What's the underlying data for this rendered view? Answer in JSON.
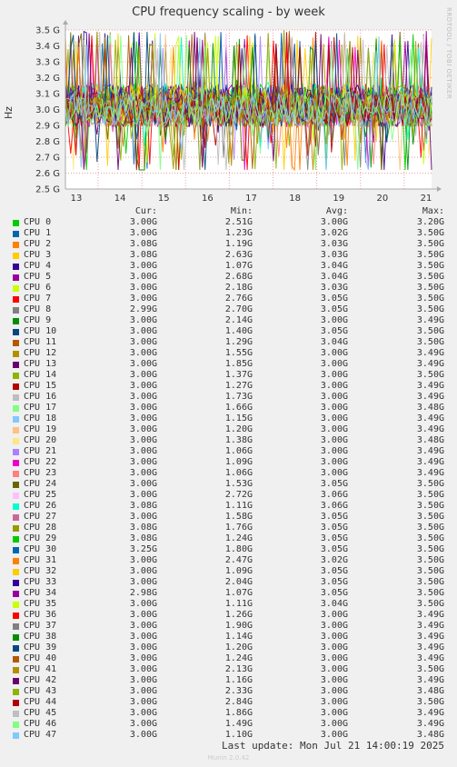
{
  "chart_data": {
    "type": "line",
    "title": "CPU frequency scaling - by week",
    "ylabel": "Hz",
    "xlabel": "",
    "ylim": [
      2.5,
      3.5
    ],
    "yticks": [
      "2.5 G",
      "2.6 G",
      "2.7 G",
      "2.8 G",
      "2.9 G",
      "3.0 G",
      "3.1 G",
      "3.2 G",
      "3.3 G",
      "3.4 G",
      "3.5 G"
    ],
    "xticks": [
      "13",
      "14",
      "15",
      "16",
      "17",
      "18",
      "19",
      "20",
      "21"
    ],
    "grid": true,
    "legend_placement": "bottom",
    "series": [
      {
        "name": "CPU 0",
        "color": "#00cc00",
        "cur": "3.00G",
        "min": "2.51G",
        "avg": "3.00G",
        "max": "3.20G"
      },
      {
        "name": "CPU 1",
        "color": "#0066b3",
        "cur": "3.00G",
        "min": "1.23G",
        "avg": "3.02G",
        "max": "3.50G"
      },
      {
        "name": "CPU 2",
        "color": "#ff8000",
        "cur": "3.08G",
        "min": "1.19G",
        "avg": "3.03G",
        "max": "3.50G"
      },
      {
        "name": "CPU 3",
        "color": "#ffcc00",
        "cur": "3.08G",
        "min": "2.63G",
        "avg": "3.03G",
        "max": "3.50G"
      },
      {
        "name": "CPU 4",
        "color": "#330099",
        "cur": "3.00G",
        "min": "1.07G",
        "avg": "3.04G",
        "max": "3.50G"
      },
      {
        "name": "CPU 5",
        "color": "#990099",
        "cur": "3.00G",
        "min": "2.68G",
        "avg": "3.04G",
        "max": "3.50G"
      },
      {
        "name": "CPU 6",
        "color": "#ccff00",
        "cur": "3.00G",
        "min": "2.18G",
        "avg": "3.03G",
        "max": "3.50G"
      },
      {
        "name": "CPU 7",
        "color": "#ff0000",
        "cur": "3.00G",
        "min": "2.76G",
        "avg": "3.05G",
        "max": "3.50G"
      },
      {
        "name": "CPU 8",
        "color": "#808080",
        "cur": "2.99G",
        "min": "2.70G",
        "avg": "3.05G",
        "max": "3.50G"
      },
      {
        "name": "CPU 9",
        "color": "#008f00",
        "cur": "3.00G",
        "min": "2.14G",
        "avg": "3.00G",
        "max": "3.49G"
      },
      {
        "name": "CPU 10",
        "color": "#00487d",
        "cur": "3.00G",
        "min": "1.40G",
        "avg": "3.05G",
        "max": "3.50G"
      },
      {
        "name": "CPU 11",
        "color": "#b35a00",
        "cur": "3.00G",
        "min": "1.29G",
        "avg": "3.04G",
        "max": "3.50G"
      },
      {
        "name": "CPU 12",
        "color": "#b38f00",
        "cur": "3.00G",
        "min": "1.55G",
        "avg": "3.00G",
        "max": "3.49G"
      },
      {
        "name": "CPU 13",
        "color": "#6b006b",
        "cur": "3.00G",
        "min": "1.85G",
        "avg": "3.00G",
        "max": "3.49G"
      },
      {
        "name": "CPU 14",
        "color": "#8fb300",
        "cur": "3.00G",
        "min": "1.37G",
        "avg": "3.00G",
        "max": "3.50G"
      },
      {
        "name": "CPU 15",
        "color": "#b30000",
        "cur": "3.00G",
        "min": "1.27G",
        "avg": "3.00G",
        "max": "3.49G"
      },
      {
        "name": "CPU 16",
        "color": "#bebebe",
        "cur": "3.00G",
        "min": "1.73G",
        "avg": "3.00G",
        "max": "3.49G"
      },
      {
        "name": "CPU 17",
        "color": "#80ff80",
        "cur": "3.00G",
        "min": "1.66G",
        "avg": "3.00G",
        "max": "3.48G"
      },
      {
        "name": "CPU 18",
        "color": "#80c9ff",
        "cur": "3.00G",
        "min": "1.15G",
        "avg": "3.00G",
        "max": "3.49G"
      },
      {
        "name": "CPU 19",
        "color": "#ffc080",
        "cur": "3.00G",
        "min": "1.20G",
        "avg": "3.00G",
        "max": "3.49G"
      },
      {
        "name": "CPU 20",
        "color": "#ffe680",
        "cur": "3.00G",
        "min": "1.38G",
        "avg": "3.00G",
        "max": "3.48G"
      },
      {
        "name": "CPU 21",
        "color": "#aa80ff",
        "cur": "3.00G",
        "min": "1.06G",
        "avg": "3.00G",
        "max": "3.49G"
      },
      {
        "name": "CPU 22",
        "color": "#ee00cc",
        "cur": "3.00G",
        "min": "1.09G",
        "avg": "3.00G",
        "max": "3.49G"
      },
      {
        "name": "CPU 23",
        "color": "#ff8080",
        "cur": "3.00G",
        "min": "1.06G",
        "avg": "3.00G",
        "max": "3.49G"
      },
      {
        "name": "CPU 24",
        "color": "#666600",
        "cur": "3.00G",
        "min": "1.53G",
        "avg": "3.05G",
        "max": "3.50G"
      },
      {
        "name": "CPU 25",
        "color": "#ffbfff",
        "cur": "3.00G",
        "min": "2.72G",
        "avg": "3.06G",
        "max": "3.50G"
      },
      {
        "name": "CPU 26",
        "color": "#00ffcc",
        "cur": "3.08G",
        "min": "1.11G",
        "avg": "3.06G",
        "max": "3.50G"
      },
      {
        "name": "CPU 27",
        "color": "#cc6699",
        "cur": "3.00G",
        "min": "1.58G",
        "avg": "3.05G",
        "max": "3.50G"
      },
      {
        "name": "CPU 28",
        "color": "#999900",
        "cur": "3.08G",
        "min": "1.76G",
        "avg": "3.05G",
        "max": "3.50G"
      },
      {
        "name": "CPU 29",
        "color": "#00cc00",
        "cur": "3.08G",
        "min": "1.24G",
        "avg": "3.05G",
        "max": "3.50G"
      },
      {
        "name": "CPU 30",
        "color": "#0066b3",
        "cur": "3.25G",
        "min": "1.80G",
        "avg": "3.05G",
        "max": "3.50G"
      },
      {
        "name": "CPU 31",
        "color": "#ff8000",
        "cur": "3.00G",
        "min": "2.47G",
        "avg": "3.02G",
        "max": "3.50G"
      },
      {
        "name": "CPU 32",
        "color": "#ffcc00",
        "cur": "3.00G",
        "min": "1.09G",
        "avg": "3.05G",
        "max": "3.50G"
      },
      {
        "name": "CPU 33",
        "color": "#330099",
        "cur": "3.00G",
        "min": "2.04G",
        "avg": "3.05G",
        "max": "3.50G"
      },
      {
        "name": "CPU 34",
        "color": "#990099",
        "cur": "2.98G",
        "min": "1.07G",
        "avg": "3.05G",
        "max": "3.50G"
      },
      {
        "name": "CPU 35",
        "color": "#ccff00",
        "cur": "3.00G",
        "min": "1.11G",
        "avg": "3.04G",
        "max": "3.50G"
      },
      {
        "name": "CPU 36",
        "color": "#ff0000",
        "cur": "3.00G",
        "min": "1.26G",
        "avg": "3.00G",
        "max": "3.49G"
      },
      {
        "name": "CPU 37",
        "color": "#808080",
        "cur": "3.00G",
        "min": "1.90G",
        "avg": "3.00G",
        "max": "3.49G"
      },
      {
        "name": "CPU 38",
        "color": "#008f00",
        "cur": "3.00G",
        "min": "1.14G",
        "avg": "3.00G",
        "max": "3.49G"
      },
      {
        "name": "CPU 39",
        "color": "#00487d",
        "cur": "3.00G",
        "min": "1.20G",
        "avg": "3.00G",
        "max": "3.49G"
      },
      {
        "name": "CPU 40",
        "color": "#b35a00",
        "cur": "3.00G",
        "min": "1.24G",
        "avg": "3.00G",
        "max": "3.49G"
      },
      {
        "name": "CPU 41",
        "color": "#b38f00",
        "cur": "3.00G",
        "min": "2.13G",
        "avg": "3.00G",
        "max": "3.50G"
      },
      {
        "name": "CPU 42",
        "color": "#6b006b",
        "cur": "3.00G",
        "min": "1.16G",
        "avg": "3.00G",
        "max": "3.49G"
      },
      {
        "name": "CPU 43",
        "color": "#8fb300",
        "cur": "3.00G",
        "min": "2.33G",
        "avg": "3.00G",
        "max": "3.48G"
      },
      {
        "name": "CPU 44",
        "color": "#b30000",
        "cur": "3.00G",
        "min": "2.84G",
        "avg": "3.00G",
        "max": "3.50G"
      },
      {
        "name": "CPU 45",
        "color": "#bebebe",
        "cur": "3.00G",
        "min": "1.86G",
        "avg": "3.00G",
        "max": "3.49G"
      },
      {
        "name": "CPU 46",
        "color": "#80ff80",
        "cur": "3.00G",
        "min": "1.49G",
        "avg": "3.00G",
        "max": "3.49G"
      },
      {
        "name": "CPU 47",
        "color": "#80c9ff",
        "cur": "3.00G",
        "min": "1.10G",
        "avg": "3.00G",
        "max": "3.48G"
      }
    ]
  },
  "legend_headers": {
    "cur": "Cur:",
    "min": "Min:",
    "avg": "Avg:",
    "max": "Max:"
  },
  "footer": {
    "last_update": "Last update: Mon Jul 21 14:00:19 2025",
    "version": "Munin 2.0.42",
    "side_credit": "RRDTOOL / TOBI OETIKER"
  }
}
